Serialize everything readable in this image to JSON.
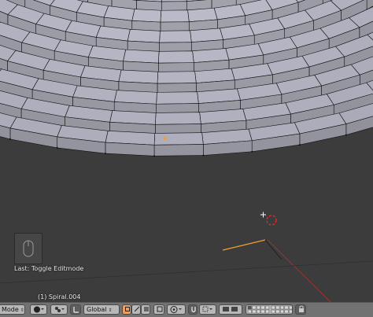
{
  "viewport": {
    "last_operator": "Last: Toggle Editmode",
    "object_label": "(1) Spiral.004"
  },
  "toolbar": {
    "mode_label": "Mode",
    "orientation_label": "Global",
    "arrow_glyph": "⇕",
    "shading_icon": "solid-sphere-icon",
    "pivot_icon": "pivot-icon",
    "manipulator_icon": "manipulator-icon",
    "layers_icon": "layers-icon",
    "snap_icon": "magnet-icon"
  },
  "colors": {
    "background": "#3c3c3c",
    "mesh_face": "#9a9aa8",
    "mesh_edge": "#000000",
    "selected_vertex": "#f0a030",
    "toolbar": "#727272"
  }
}
